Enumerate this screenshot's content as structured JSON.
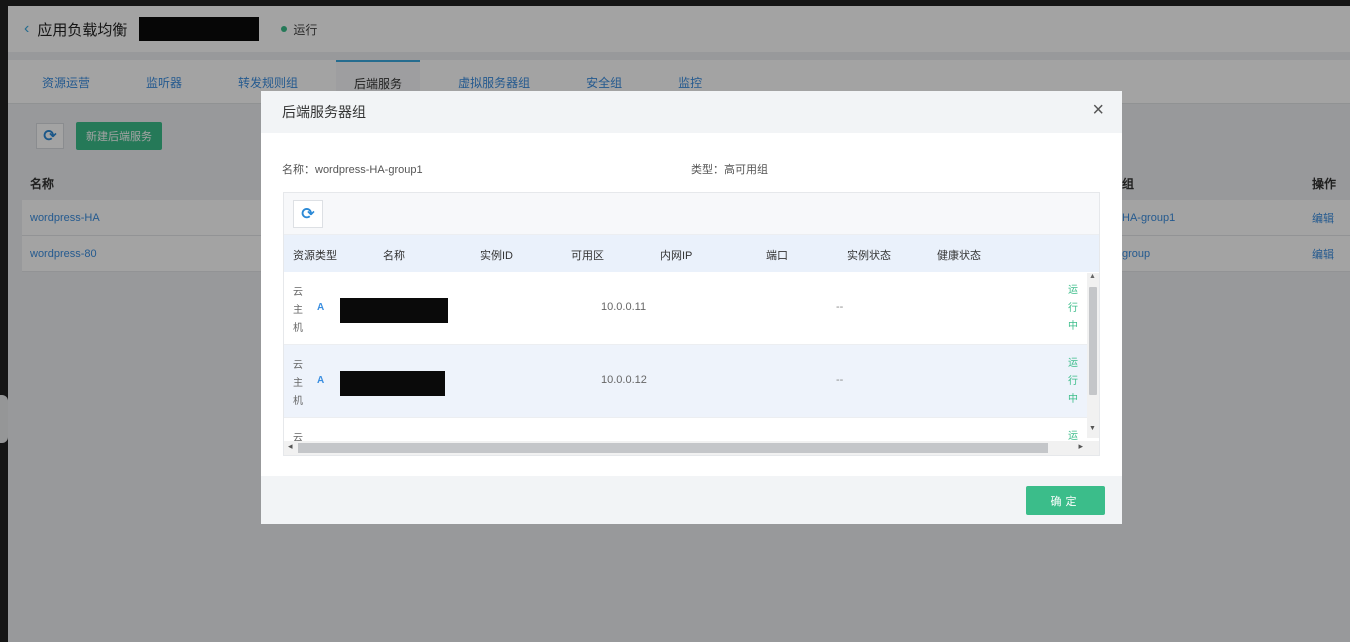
{
  "app": {
    "back_icon": "‹",
    "title": "应用负载均衡",
    "status": "运行",
    "tabs": [
      "资源运营",
      "监听器",
      "转发规则组",
      "后端服务",
      "虚拟服务器组",
      "安全组",
      "监控"
    ],
    "active_tab": "后端服务",
    "refresh_icon": "refresh-icon",
    "create_button": "新建后端服务",
    "table_headers": {
      "name": "名称",
      "group": "组",
      "ops": "操作"
    },
    "rows": [
      {
        "name": "wordpress-HA",
        "group": "HA-group1",
        "op": "编辑"
      },
      {
        "name": "wordpress-80",
        "group": "group",
        "op": "编辑"
      }
    ]
  },
  "modal": {
    "title": "后端服务器组",
    "close_icon": "×",
    "name_label": "名称：wordpress-HA-group1",
    "type_label": "类型：高可用组",
    "columns": [
      "资源类型",
      "名称",
      "实例ID",
      "可用区",
      "内网IP",
      "端口",
      "实例状态",
      "健康状态"
    ],
    "rows": [
      {
        "type": "云主机",
        "az": "A",
        "ip": "10.0.0.11",
        "health": "--",
        "state": "运行中"
      },
      {
        "type": "云主机",
        "az": "A",
        "ip": "10.0.0.12",
        "health": "--",
        "state": "运行中"
      }
    ],
    "partial_row": {
      "type": "云",
      "state": "运"
    },
    "ok_button": "确定"
  },
  "colors": {
    "accent_green": "#3bbd8a",
    "link_blue": "#3a8ee0",
    "header_blue_bg": "#eaf1fb"
  }
}
